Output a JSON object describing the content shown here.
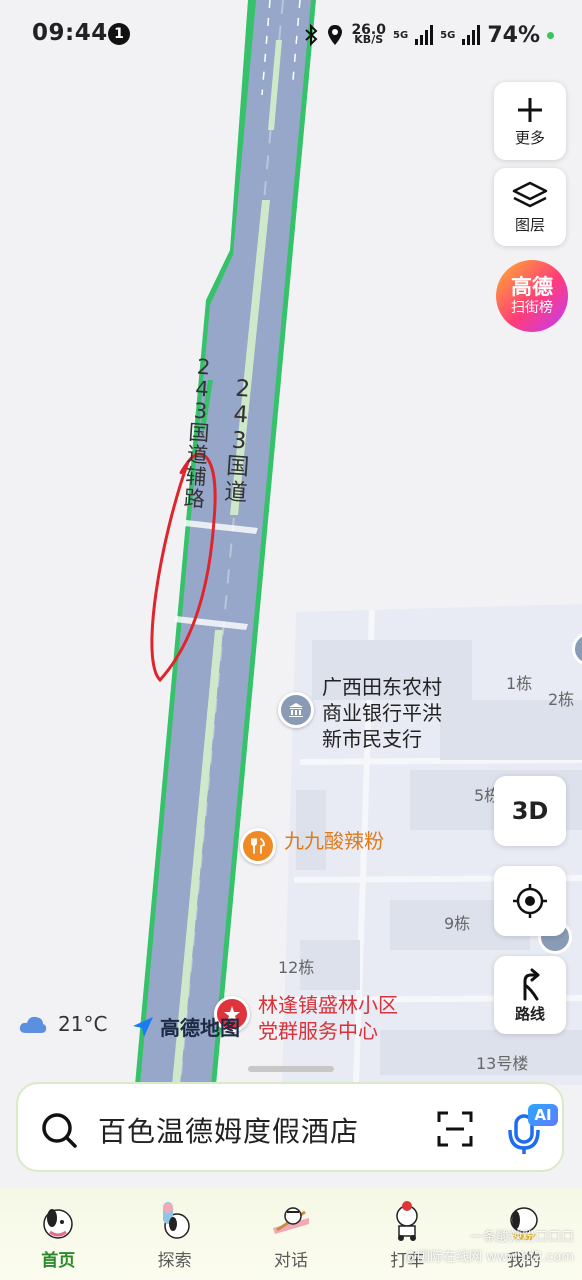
{
  "status_bar": {
    "time": "09:44",
    "notification_count": "1",
    "net_speed_value": "26.0",
    "net_speed_unit": "KB/S",
    "network_1": "5G",
    "network_2": "5G",
    "battery": "74%"
  },
  "map": {
    "road_main": [
      "2",
      "4",
      "3",
      "国",
      "道"
    ],
    "road_aux": [
      "2",
      "4",
      "3",
      "国",
      "道",
      "辅",
      "路"
    ],
    "pois": [
      {
        "name_lines": [
          "广西田东农村",
          "商业银行平洪",
          "新市民支行"
        ],
        "icon": "bank-icon",
        "color": "#8a9bb5"
      },
      {
        "name_lines": [
          "九九酸辣粉"
        ],
        "icon": "restaurant-icon",
        "color": "#f08a24"
      },
      {
        "name_lines": [
          "林逢镇盛林小区",
          "党群服务中心"
        ],
        "icon": "party-office-icon",
        "color": "#e0343c"
      }
    ],
    "buildings": [
      "1栋",
      "2栋",
      "5栋",
      "9栋",
      "12栋",
      "13号楼"
    ]
  },
  "controls": {
    "more_label": "更多",
    "layers_label": "图层",
    "gaode_rank_line1": "高德",
    "gaode_rank_line2": "扫街榜",
    "view_3d_label": "3D",
    "route_label": "路线"
  },
  "weather": {
    "temperature": "21°C",
    "icon": "cloud-icon"
  },
  "brand": {
    "logo_text": "高德地图"
  },
  "search": {
    "text": "百色温德姆度假酒店",
    "ai_badge": "AI"
  },
  "bottom_nav": [
    {
      "label": "首页",
      "active": true
    },
    {
      "label": "探索",
      "active": false
    },
    {
      "label": "对话",
      "active": false
    },
    {
      "label": "打车",
      "active": false
    },
    {
      "label": "我的",
      "active": false
    }
  ],
  "watermark": {
    "line1": "一条酸辣粉口口口",
    "line2": "@国际在线网 www.bf2.com"
  },
  "colors": {
    "road": "#97a7c9",
    "road_border": "#36c26a",
    "annotation": "#e0242c"
  }
}
